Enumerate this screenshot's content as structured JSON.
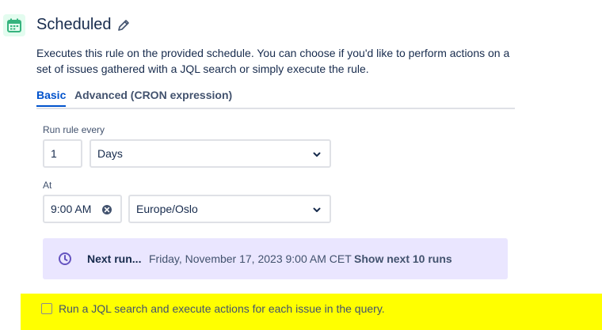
{
  "trigger": {
    "title": "Scheduled",
    "description": "Executes this rule on the provided schedule. You can choose if you'd like to perform actions on a set of issues gathered with a JQL search or simply execute the rule."
  },
  "tabs": [
    {
      "label": "Basic",
      "active": true
    },
    {
      "label": "Advanced (CRON expression)",
      "active": false
    }
  ],
  "schedule": {
    "run_every_label": "Run rule every",
    "interval_value": "1",
    "interval_unit": "Days",
    "at_label": "At",
    "time_value": "9:00 AM",
    "timezone": "Europe/Oslo"
  },
  "next_run": {
    "label": "Next run...",
    "date": "Friday, November 17, 2023 9:00 AM CET",
    "show_link": "Show next 10 runs"
  },
  "jql_option": {
    "label": "Run a JQL search and execute actions for each issue in the query.",
    "checked": false
  },
  "icons": {
    "header": "calendar-icon",
    "edit": "pencil-icon",
    "dropdown": "chevron-down-icon",
    "clear": "clear-icon",
    "next_run": "clock-icon"
  },
  "colors": {
    "accent": "#0052cc",
    "header_icon": "#36b37e",
    "info_bg": "#eae6ff",
    "info_icon": "#6554c0",
    "highlight": "#ffff00"
  }
}
